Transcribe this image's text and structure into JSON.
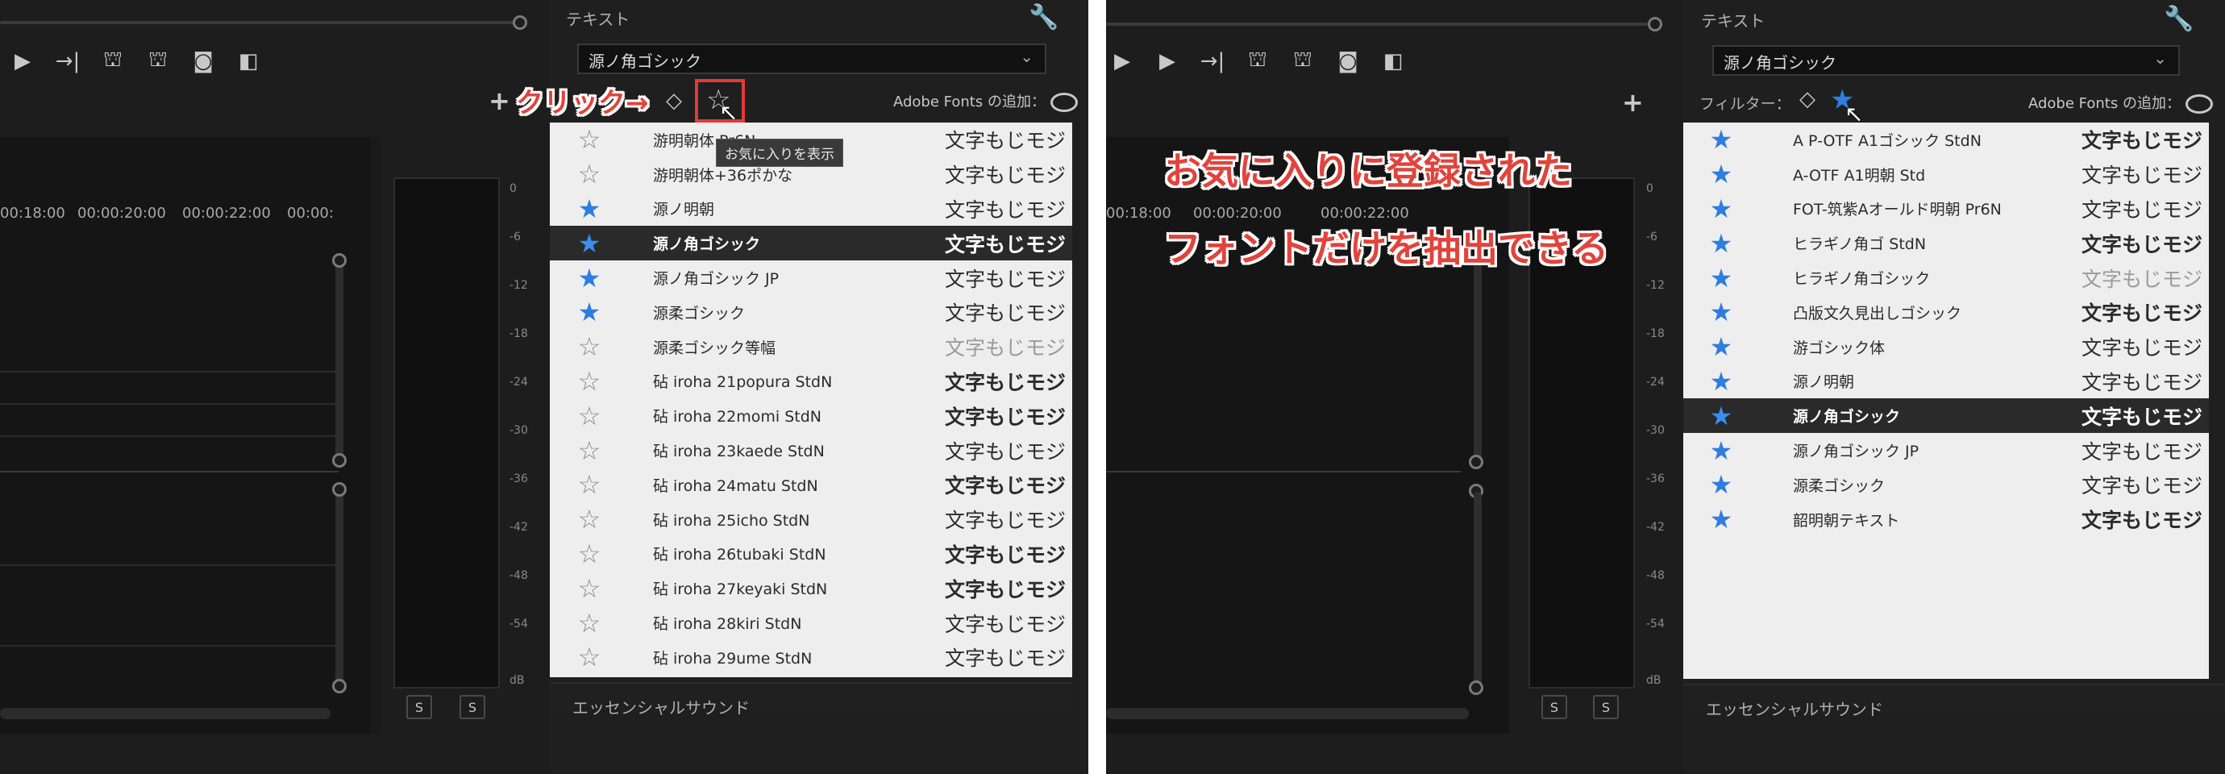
{
  "annotation_click": "クリック→",
  "annotation_result": [
    "お気に入りに登録された",
    "フォントだけを抽出できる"
  ],
  "tooltip": "お気に入りを表示",
  "panel_title": "テキスト",
  "font_dropdown": "源ノ角ゴシック",
  "adobe_fonts_label": "Adobe Fonts の追加：",
  "filter_label": "フィルター：",
  "essential_sound": "エッセンシャルサウンド",
  "timecodes": [
    "00:18:00",
    "00:00:20:00",
    "00:00:22:00",
    "00:00:"
  ],
  "meter_scale": [
    "0",
    "-6",
    "-12",
    "-18",
    "-24",
    "-30",
    "-36",
    "-42",
    "-48",
    "-54",
    "dB"
  ],
  "solo_buttons": [
    "S",
    "S"
  ],
  "sample_text": "文字もじモジ",
  "colors": {
    "favorite_star": "#2e7de0",
    "annotation": "#e0443c",
    "selected_row": "#2a2a2a"
  },
  "left_fonts": [
    {
      "name": "游明朝体 Pr6N",
      "fav": false,
      "sel": false,
      "style": "normal"
    },
    {
      "name": "游明朝体+36ポかな",
      "fav": false,
      "sel": false,
      "style": "normal"
    },
    {
      "name": "源ノ明朝",
      "fav": true,
      "sel": false,
      "style": "normal"
    },
    {
      "name": "源ノ角ゴシック",
      "fav": true,
      "sel": true,
      "style": "bold"
    },
    {
      "name": "源ノ角ゴシック JP",
      "fav": true,
      "sel": false,
      "style": "normal"
    },
    {
      "name": "源柔ゴシック",
      "fav": true,
      "sel": false,
      "style": "normal"
    },
    {
      "name": "源柔ゴシック等幅",
      "fav": false,
      "sel": false,
      "style": "gray"
    },
    {
      "name": "砧 iroha 21popura StdN",
      "fav": false,
      "sel": false,
      "style": "bold"
    },
    {
      "name": "砧 iroha 22momi StdN",
      "fav": false,
      "sel": false,
      "style": "bold"
    },
    {
      "name": "砧 iroha 23kaede StdN",
      "fav": false,
      "sel": false,
      "style": "normal"
    },
    {
      "name": "砧 iroha 24matu StdN",
      "fav": false,
      "sel": false,
      "style": "bold"
    },
    {
      "name": "砧 iroha 25icho StdN",
      "fav": false,
      "sel": false,
      "style": "normal"
    },
    {
      "name": "砧 iroha 26tubaki StdN",
      "fav": false,
      "sel": false,
      "style": "bold"
    },
    {
      "name": "砧 iroha 27keyaki StdN",
      "fav": false,
      "sel": false,
      "style": "bold"
    },
    {
      "name": "砧 iroha 28kiri StdN",
      "fav": false,
      "sel": false,
      "style": "normal"
    },
    {
      "name": "砧 iroha 29ume StdN",
      "fav": false,
      "sel": false,
      "style": "normal"
    }
  ],
  "right_fonts": [
    {
      "name": "A P-OTF A1ゴシック StdN",
      "fav": true,
      "sel": false,
      "style": "bold"
    },
    {
      "name": "A-OTF A1明朝 Std",
      "fav": true,
      "sel": false,
      "style": "normal"
    },
    {
      "name": "FOT-筑紫Aオールド明朝 Pr6N",
      "fav": true,
      "sel": false,
      "style": "normal"
    },
    {
      "name": "ヒラギノ角ゴ StdN",
      "fav": true,
      "sel": false,
      "style": "bold"
    },
    {
      "name": "ヒラギノ角ゴシック",
      "fav": true,
      "sel": false,
      "style": "gray"
    },
    {
      "name": "凸版文久見出しゴシック",
      "fav": true,
      "sel": false,
      "style": "bold"
    },
    {
      "name": "游ゴシック体",
      "fav": true,
      "sel": false,
      "style": "normal"
    },
    {
      "name": "源ノ明朝",
      "fav": true,
      "sel": false,
      "style": "normal"
    },
    {
      "name": "源ノ角ゴシック",
      "fav": true,
      "sel": true,
      "style": "bold"
    },
    {
      "name": "源ノ角ゴシック JP",
      "fav": true,
      "sel": false,
      "style": "normal"
    },
    {
      "name": "源柔ゴシック",
      "fav": true,
      "sel": false,
      "style": "normal"
    },
    {
      "name": "韶明朝テキスト",
      "fav": true,
      "sel": false,
      "style": "bold"
    }
  ]
}
